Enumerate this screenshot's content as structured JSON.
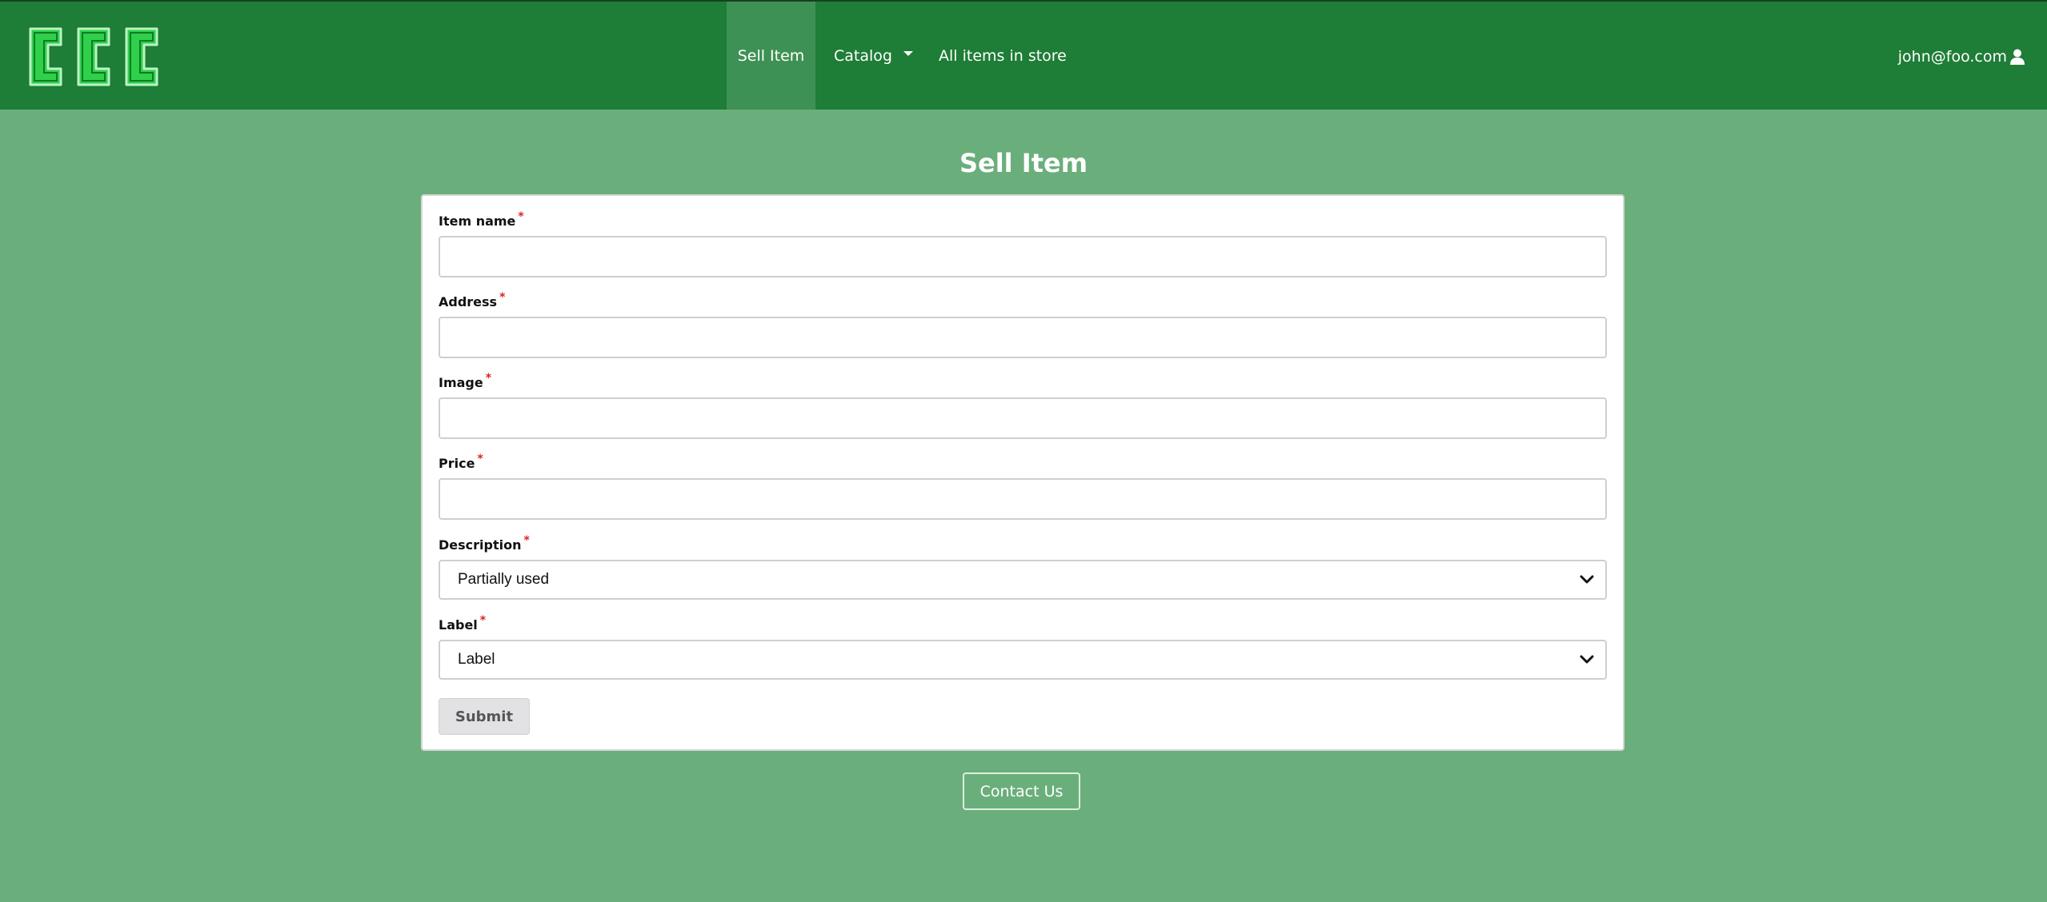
{
  "brand": {
    "logo_text": "CCC",
    "logo_color": "#2fd04a"
  },
  "nav": {
    "items": [
      {
        "label": "Sell Item",
        "active": true
      },
      {
        "label": "Catalog",
        "dropdown": true
      },
      {
        "label": "All items in store"
      }
    ]
  },
  "user": {
    "email": "john@foo.com",
    "icon": "user-icon"
  },
  "page": {
    "title": "Sell Item"
  },
  "form": {
    "required_marker": "*",
    "fields": [
      {
        "label": "Item name",
        "value": ""
      },
      {
        "label": "Address",
        "value": ""
      },
      {
        "label": "Image",
        "value": ""
      },
      {
        "label": "Price",
        "value": ""
      },
      {
        "label": "Description",
        "selected": "Partially used"
      },
      {
        "label": "Label",
        "selected": "Label"
      }
    ],
    "submit_label": "Submit"
  },
  "footer": {
    "contact_label": "Contact Us"
  },
  "colors": {
    "page_bg": "#6aaf7b",
    "header_bg": "#1e7d36",
    "active_nav_bg": "#3e9154",
    "required": "#e02020"
  }
}
